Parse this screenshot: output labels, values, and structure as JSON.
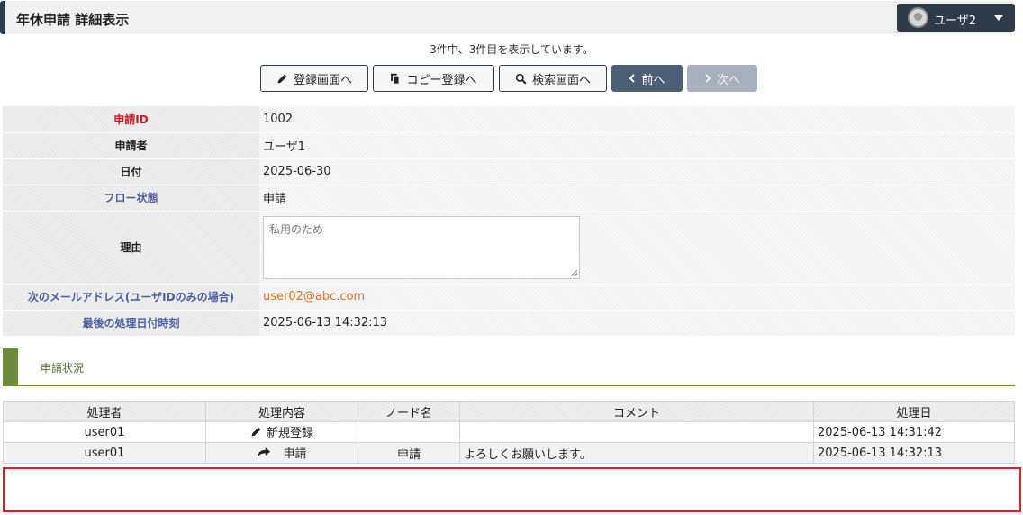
{
  "header": {
    "title": "年休申請 詳細表示",
    "user_name": "ユーザ2"
  },
  "record_info": "3件中、3件目を表示しています。",
  "toolbar": {
    "register_label": "登録画面へ",
    "copy_label": "コピー登録へ",
    "search_label": "検索画面へ",
    "prev_label": "前へ",
    "next_label": "次へ"
  },
  "detail": {
    "id_label": "申請ID",
    "id_value": "1002",
    "applicant_label": "申請者",
    "applicant_value": "ユーザ1",
    "date_label": "日付",
    "date_value": "2025-06-30",
    "flow_label": "フロー状態",
    "flow_value": "申請",
    "reason_label": "理由",
    "reason_value": "私用のため",
    "email_label": "次のメールアドレス(ユーザIDのみの場合)",
    "email_value": "user02@abc.com",
    "last_label": "最後の処理日付時刻",
    "last_value": "2025-06-13 14:32:13"
  },
  "status_section": {
    "title": "申請状況"
  },
  "history": {
    "headers": [
      "処理者",
      "処理内容",
      "ノード名",
      "コメント",
      "処理日"
    ],
    "rows": [
      {
        "processor": "user01",
        "action": "新規登録",
        "action_icon": "pencil-icon",
        "node": "",
        "comment": "",
        "date": "2025-06-13 14:31:42"
      },
      {
        "processor": "user01",
        "action": "申請",
        "action_icon": "share-arrow-icon",
        "node": "申請",
        "comment": "よろしくお願いします。",
        "date": "2025-06-13 14:32:13"
      }
    ]
  },
  "colors": {
    "header_dark": "#2d3e50",
    "section_green": "#6e8b3d",
    "required_red": "#c0202a",
    "email_orange": "#e0701c",
    "highlight_frame": "#d9222a"
  }
}
